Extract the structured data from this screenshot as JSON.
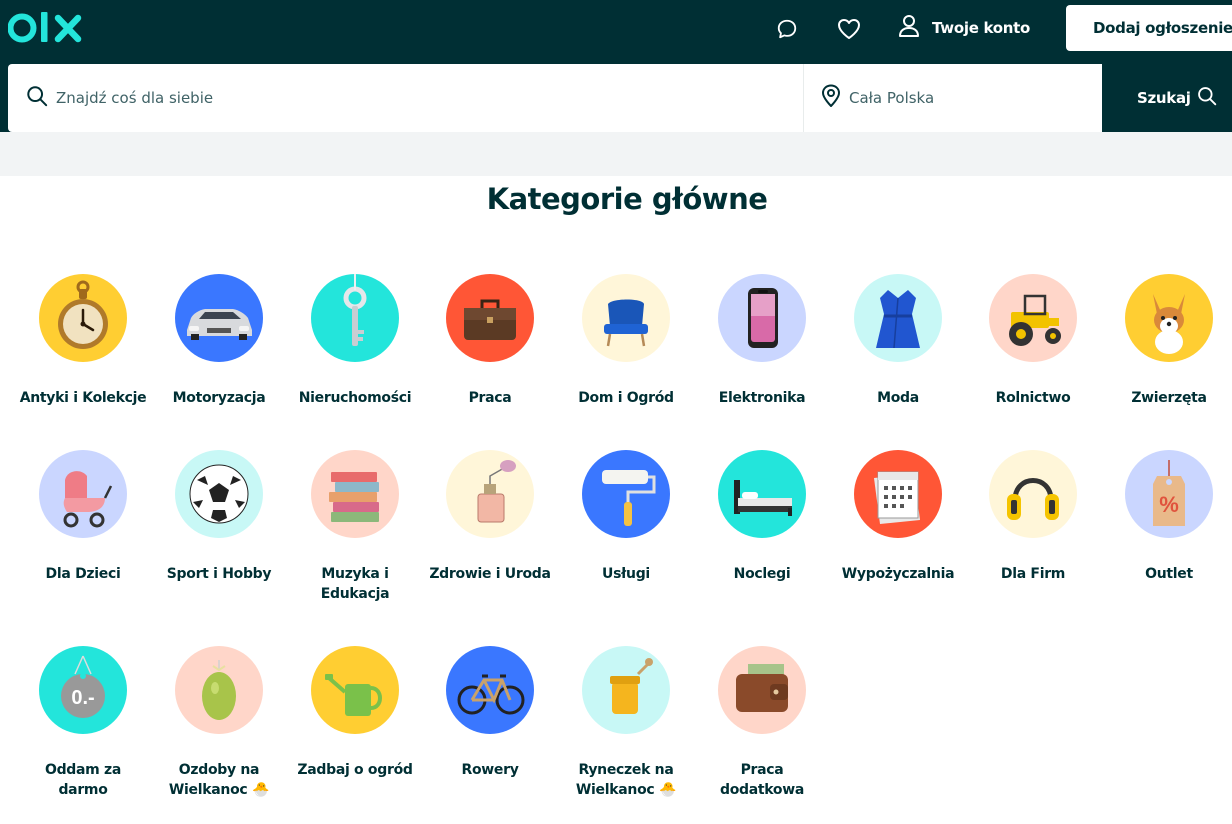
{
  "header": {
    "logo_text": "olx",
    "account_label": "Twoje konto",
    "post_button": "Dodaj ogłoszenie"
  },
  "search": {
    "placeholder": "Znajdź coś dla siebie",
    "location_placeholder": "Cała Polska",
    "button_label": "Szukaj"
  },
  "main": {
    "title": "Kategorie główne",
    "categories": [
      {
        "line1": "Antyki i Kolekcje",
        "line2": "",
        "icon": "pocket-watch-icon",
        "color": "#ffce32"
      },
      {
        "line1": "Motoryzacja",
        "line2": "",
        "icon": "car-icon",
        "color": "#3a77ff"
      },
      {
        "line1": "Nieruchomości",
        "line2": "",
        "icon": "key-icon",
        "color": "#23e5db"
      },
      {
        "line1": "Praca",
        "line2": "",
        "icon": "briefcase-icon",
        "color": "#ff5636"
      },
      {
        "line1": "Dom i Ogród",
        "line2": "",
        "icon": "armchair-icon",
        "color": "#fff6d9"
      },
      {
        "line1": "Elektronika",
        "line2": "",
        "icon": "smartphone-icon",
        "color": "#cad6ff"
      },
      {
        "line1": "Moda",
        "line2": "",
        "icon": "dress-icon",
        "color": "#c8f8f6"
      },
      {
        "line1": "Rolnictwo",
        "line2": "",
        "icon": "tractor-icon",
        "color": "#ffd6c9"
      },
      {
        "line1": "Zwierzęta",
        "line2": "",
        "icon": "dog-icon",
        "color": "#ffce32"
      },
      {
        "line1": "Dla Dzieci",
        "line2": "",
        "icon": "stroller-icon",
        "color": "#cad6ff"
      },
      {
        "line1": "Sport i Hobby",
        "line2": "",
        "icon": "football-icon",
        "color": "#c8f8f6"
      },
      {
        "line1": "Muzyka i",
        "line2": "Edukacja",
        "icon": "books-icon",
        "color": "#ffd6c9"
      },
      {
        "line1": "Zdrowie i Uroda",
        "line2": "",
        "icon": "perfume-icon",
        "color": "#fff6d9"
      },
      {
        "line1": "Usługi",
        "line2": "",
        "icon": "paint-roller-icon",
        "color": "#3a77ff"
      },
      {
        "line1": "Noclegi",
        "line2": "",
        "icon": "bed-icon",
        "color": "#23e5db"
      },
      {
        "line1": "Wypożyczalnia",
        "line2": "",
        "icon": "calendar-icon",
        "color": "#ff5636"
      },
      {
        "line1": "Dla Firm",
        "line2": "",
        "icon": "ear-muffs-icon",
        "color": "#fff6d9"
      },
      {
        "line1": "Outlet",
        "line2": "",
        "icon": "price-tag-icon",
        "color": "#cad6ff"
      },
      {
        "line1": "Oddam za",
        "line2": "darmo",
        "icon": "free-tag-icon",
        "color": "#23e5db"
      },
      {
        "line1": "Ozdoby na",
        "line2": "Wielkanoc 🐣",
        "icon": "easter-egg-icon",
        "color": "#ffd6c9"
      },
      {
        "line1": "Zadbaj o ogród",
        "line2": "",
        "icon": "watering-can-icon",
        "color": "#ffce32"
      },
      {
        "line1": "Rowery",
        "line2": "",
        "icon": "bicycle-icon",
        "color": "#3a77ff"
      },
      {
        "line1": "Ryneczek na",
        "line2": "Wielkanoc 🐣",
        "icon": "honey-jar-icon",
        "color": "#c8f8f6"
      },
      {
        "line1": "Praca",
        "line2": "dodatkowa",
        "icon": "wallet-icon",
        "color": "#ffd6c9"
      }
    ]
  }
}
